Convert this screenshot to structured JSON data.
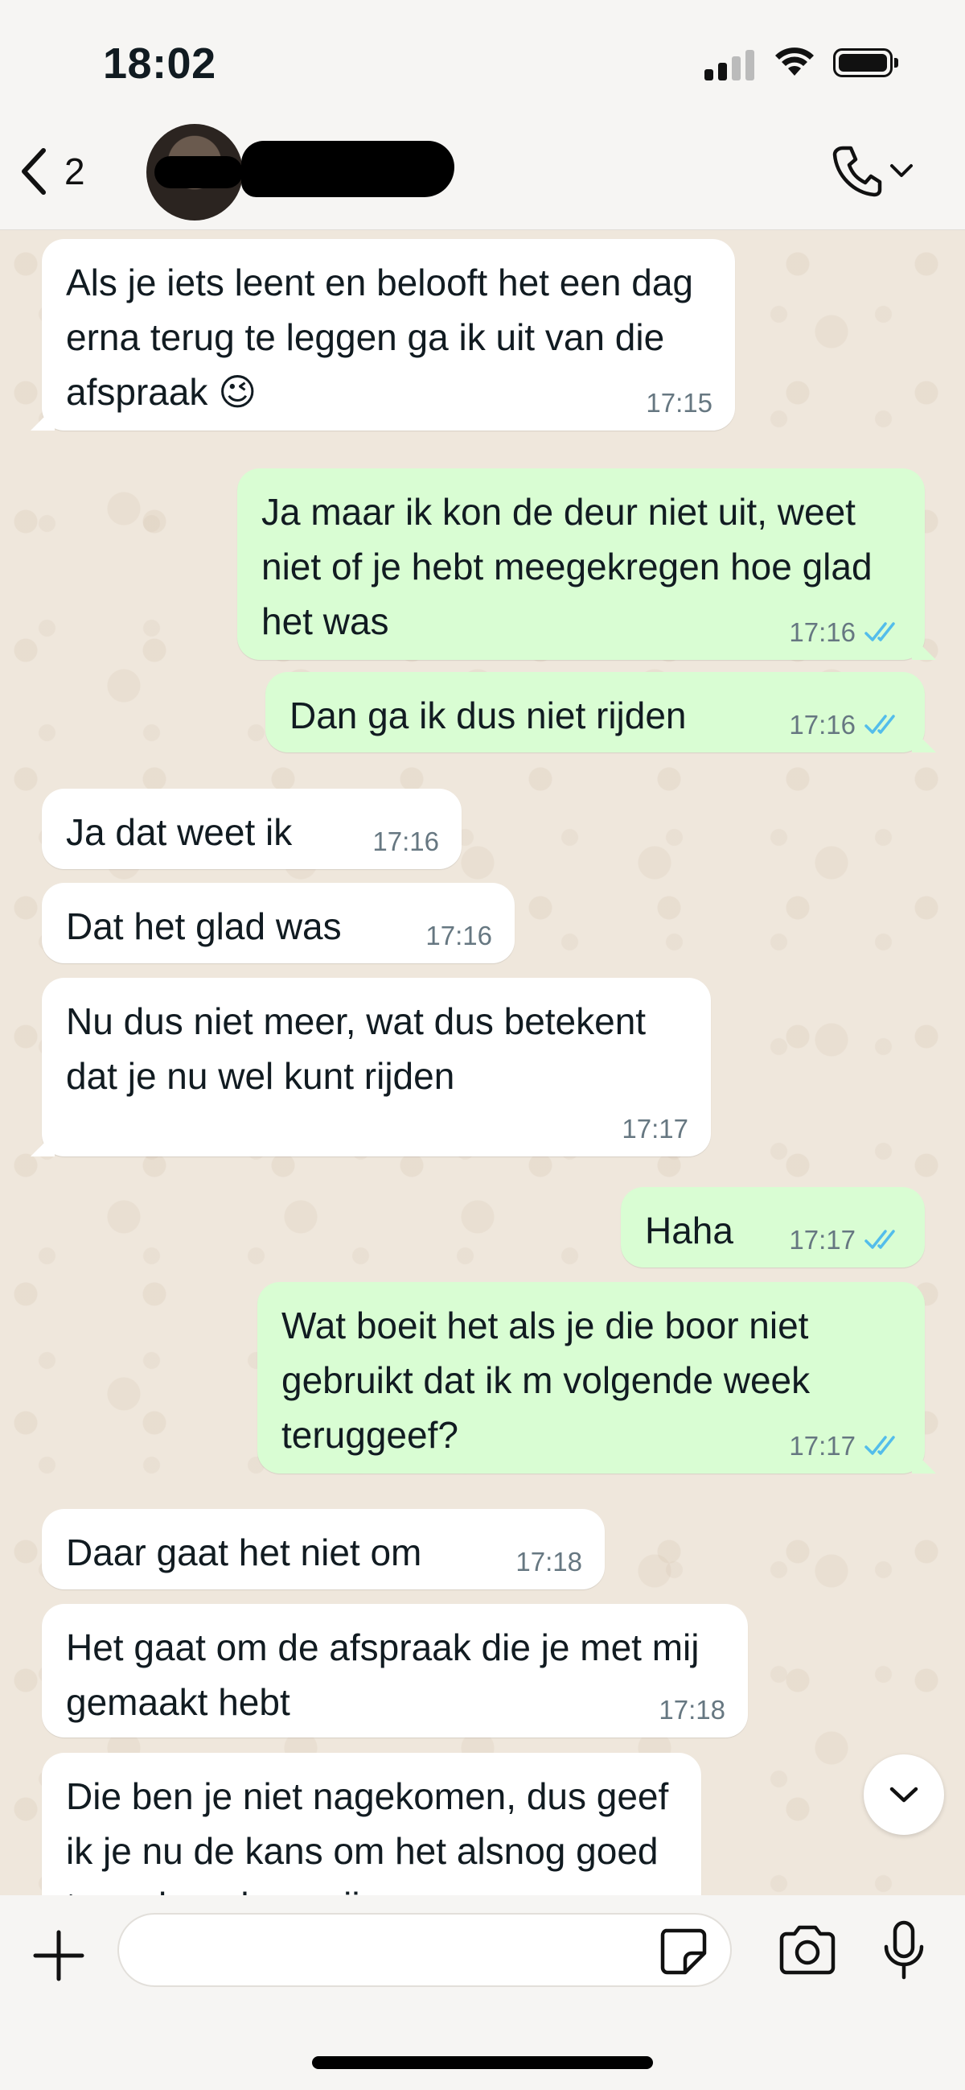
{
  "status_bar": {
    "time": "18:02"
  },
  "header": {
    "back_count": "2"
  },
  "messages": [
    {
      "dir": "in",
      "text": "Als je iets leent en belooft het een dag erna terug te leggen ga ik uit van die afspraak 😉",
      "time": "17:15"
    },
    {
      "dir": "out",
      "text": "Ja maar ik kon de deur niet uit, weet niet of je hebt meegekregen hoe glad het was",
      "time": "17:16",
      "status": "read"
    },
    {
      "dir": "out",
      "text": "Dan ga ik dus niet rijden",
      "time": "17:16",
      "status": "read"
    },
    {
      "dir": "in",
      "text": "Ja dat weet ik",
      "time": "17:16"
    },
    {
      "dir": "in",
      "text": "Dat het glad was",
      "time": "17:16"
    },
    {
      "dir": "in",
      "text": "Nu dus niet meer, wat dus betekent dat je nu wel kunt rijden",
      "time": "17:17"
    },
    {
      "dir": "out",
      "text": "Haha",
      "time": "17:17",
      "status": "read"
    },
    {
      "dir": "out",
      "text": "Wat boeit het als je die boor niet gebruikt dat ik m volgende week teruggeef?",
      "time": "17:17",
      "status": "read"
    },
    {
      "dir": "in",
      "text": "Daar gaat het niet om",
      "time": "17:18"
    },
    {
      "dir": "in",
      "text": "Het gaat om de afspraak die je met mij gemaakt hebt",
      "time": "17:18"
    },
    {
      "dir": "in",
      "text": "Die ben je niet nagekomen, dus geef ik je nu de kans om het alsnog goed te maken door mijn",
      "time": ""
    }
  ],
  "colors": {
    "outgoing": "#d9fdd3",
    "incoming": "#ffffff",
    "read_ticks": "#53bdeb"
  },
  "icons": [
    "back-chevron-icon",
    "phone-icon",
    "chevron-down-icon",
    "plus-icon",
    "sticker-icon",
    "camera-icon",
    "microphone-icon",
    "double-check-icon"
  ]
}
